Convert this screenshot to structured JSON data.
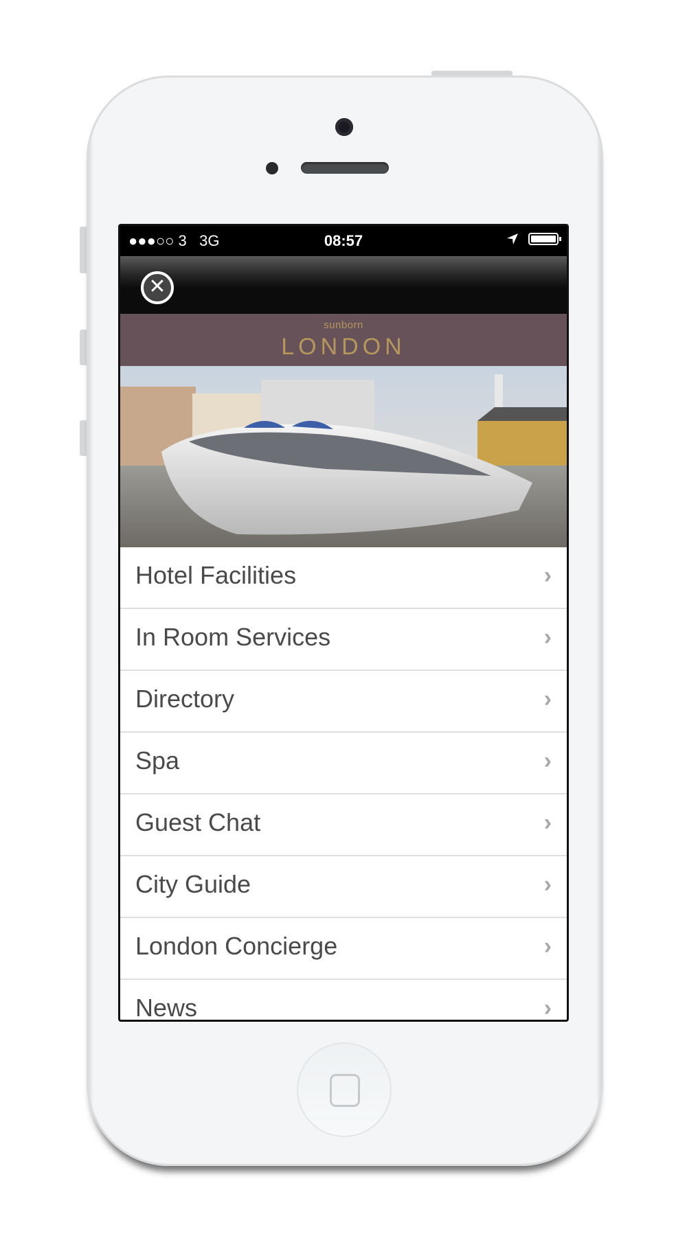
{
  "status_bar": {
    "carrier": "●●●○○ 3",
    "network": "3G",
    "time": "08:57",
    "location_icon": "location-arrow-icon",
    "battery_icon": "battery-full-icon"
  },
  "nav": {
    "close_icon": "close-circle-icon",
    "close_glyph": "✕"
  },
  "brand": {
    "small": "sunborn",
    "large": "LONDON",
    "background": "#67525a",
    "text_color": "#b5975e"
  },
  "menu": {
    "chevron": "›",
    "items": [
      {
        "label": "Hotel Facilities"
      },
      {
        "label": "In Room Services"
      },
      {
        "label": "Directory"
      },
      {
        "label": "Spa"
      },
      {
        "label": "Guest Chat"
      },
      {
        "label": "City Guide"
      },
      {
        "label": "London Concierge"
      },
      {
        "label": "News"
      }
    ]
  }
}
